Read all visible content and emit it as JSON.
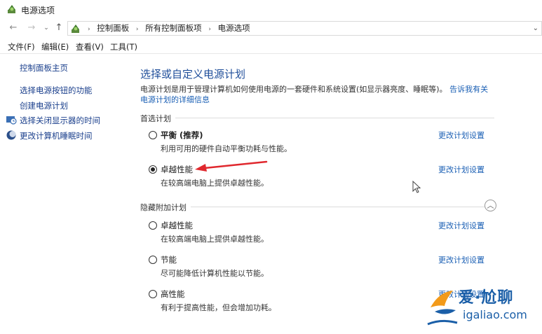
{
  "window": {
    "title": "电源选项"
  },
  "nav": {
    "back_icon": "←",
    "forward_icon": "→",
    "recent_icon": "⌄",
    "up_icon": "↑",
    "breadcrumbs": [
      "控制面板",
      "所有控制面板项",
      "电源选项"
    ],
    "separator": "›",
    "dropdown_icon": "⌄"
  },
  "menu": [
    {
      "label": "文件(F)"
    },
    {
      "label": "编辑(E)"
    },
    {
      "label": "查看(V)"
    },
    {
      "label": "工具(T)"
    }
  ],
  "sidebar": {
    "home": "控制面板主页",
    "items": [
      {
        "label": "选择电源按钮的功能",
        "icon": ""
      },
      {
        "label": "创建电源计划",
        "icon": ""
      },
      {
        "label": "选择关闭显示器的时间",
        "icon": "monitor-clock-icon"
      },
      {
        "label": "更改计算机睡眠时间",
        "icon": "moon-icon"
      }
    ]
  },
  "main": {
    "heading": "选择或自定义电源计划",
    "description": "电源计划是用于管理计算机如何使用电源的一套硬件和系统设置(如显示器亮度、睡眠等)。",
    "description_link": "告诉我有关电源计划的详细信息",
    "preferred_group": "首选计划",
    "hidden_group": "隐藏附加计划",
    "collapse_icon": "︿",
    "preferred_plans": [
      {
        "name": "平衡 (推荐)",
        "desc": "利用可用的硬件自动平衡功耗与性能。",
        "link": "更改计划设置",
        "selected": false
      },
      {
        "name": "卓越性能",
        "desc": "在较高端电脑上提供卓越性能。",
        "link": "更改计划设置",
        "selected": true
      }
    ],
    "hidden_plans": [
      {
        "name": "卓越性能",
        "desc": "在较高端电脑上提供卓越性能。",
        "link": "更改计划设置",
        "selected": false
      },
      {
        "name": "节能",
        "desc": "尽可能降低计算机性能以节能。",
        "link": "更改计划设置",
        "selected": false
      },
      {
        "name": "高性能",
        "desc": "有利于提高性能，但会增加功耗。",
        "link": "更改计划设置",
        "selected": false
      }
    ]
  },
  "watermark": {
    "title": "爱·尬聊",
    "url": "igaliao.com"
  },
  "colors": {
    "accent_link": "#1a5fb4",
    "heading": "#1f4e9a",
    "arrow": "#e0282e",
    "watermark": "#1b5fa8"
  }
}
